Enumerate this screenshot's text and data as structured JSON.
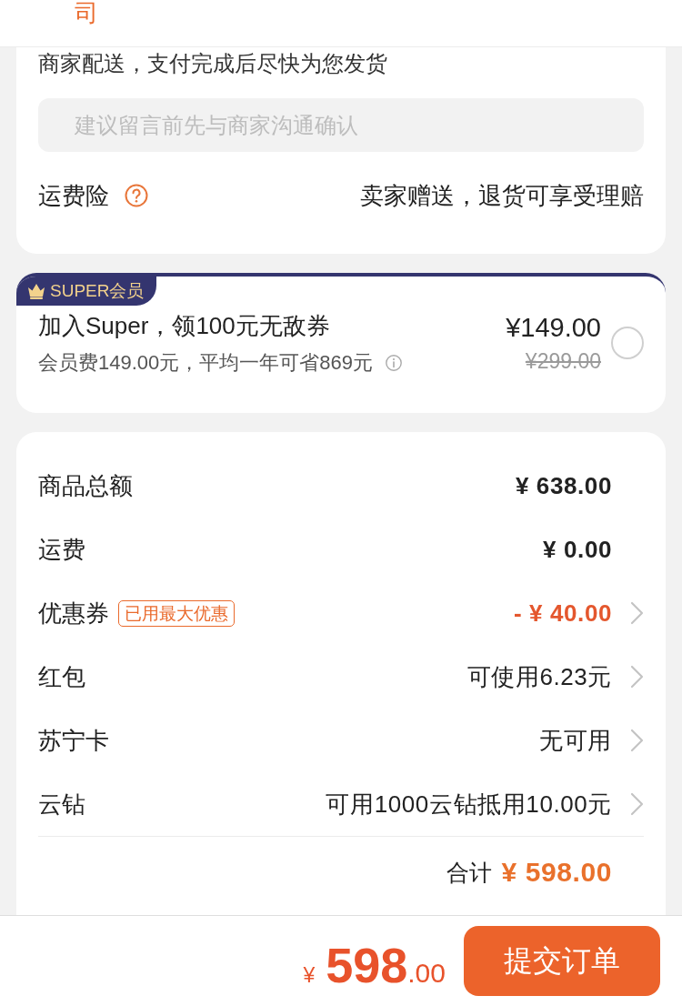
{
  "header": {
    "title": "司"
  },
  "delivery_note": {
    "text": "商家配送，支付完成后尽快为您发货"
  },
  "remark_field": {
    "placeholder": "建议留言前先与商家沟通确认"
  },
  "shipping_insurance": {
    "label": "运费险",
    "value": "卖家赠送，退货可享受理赔"
  },
  "super_membership": {
    "badge": "SUPER会员",
    "title": "加入Super，领100元无敌券",
    "subtitle": "会员费149.00元，平均一年可省869元",
    "price": "¥149.00",
    "original_price": "¥299.00",
    "selected": false
  },
  "summary": {
    "rows": [
      {
        "label": "商品总额",
        "value": "¥ 638.00",
        "kind": "amount",
        "arrow": false
      },
      {
        "label": "运费",
        "value": "¥ 0.00",
        "kind": "amount",
        "arrow": false
      },
      {
        "label": "优惠券",
        "tag": "已用最大优惠",
        "value": "- ¥ 40.00",
        "kind": "discount",
        "arrow": true
      },
      {
        "label": "红包",
        "value": "可使用6.23元",
        "kind": "info",
        "arrow": true
      },
      {
        "label": "苏宁卡",
        "value": "无可用",
        "kind": "info",
        "arrow": true
      },
      {
        "label": "云钻",
        "value": "可用1000云钻抵用10.00元",
        "kind": "info",
        "arrow": true
      }
    ],
    "total": {
      "label": "合计",
      "value": "¥ 598.00"
    }
  },
  "footer": {
    "currency": "¥",
    "amount": "598",
    "decimals": ".00",
    "submit": "提交订单"
  }
}
